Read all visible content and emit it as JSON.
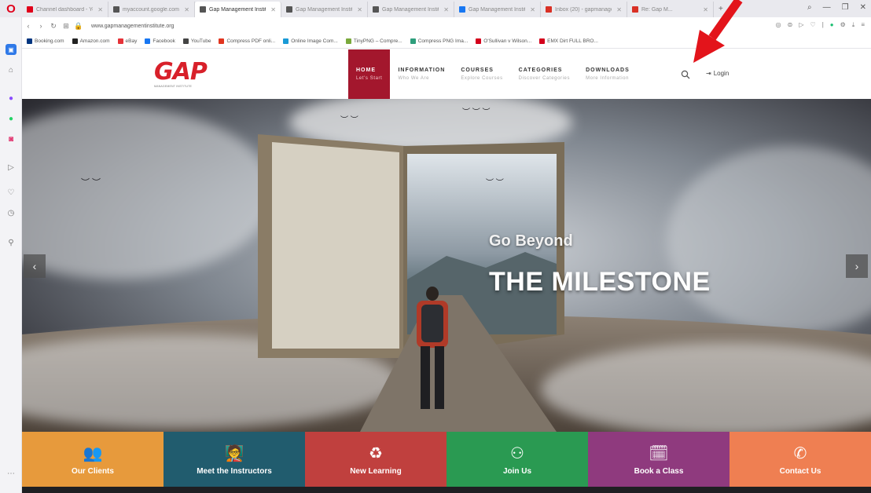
{
  "browser": {
    "tabs": [
      {
        "label": "Channel dashboard - YouT",
        "color": "#e0001a",
        "active": false
      },
      {
        "label": "myaccount.google.com",
        "color": "#555",
        "active": false
      },
      {
        "label": "Gap Management Institute",
        "color": "#555",
        "active": true
      },
      {
        "label": "Gap Management Institute",
        "color": "#555",
        "active": false
      },
      {
        "label": "Gap Management Institute",
        "color": "#555",
        "active": false
      },
      {
        "label": "Gap Management Institute",
        "color": "#1877f2",
        "active": false
      },
      {
        "label": "Inbox (20) - gapmanagem",
        "color": "#d93025",
        "active": false
      },
      {
        "label": "Re: Gap M...",
        "color": "#d93025",
        "active": false
      }
    ],
    "url": "www.gapmanagementinstitute.org",
    "bookmarks": [
      {
        "label": "Booking.com",
        "color": "#003580"
      },
      {
        "label": "Amazon.com",
        "color": "#222"
      },
      {
        "label": "eBay",
        "color": "#e53238"
      },
      {
        "label": "Facebook",
        "color": "#1877f2"
      },
      {
        "label": "YouTube",
        "color": "#444"
      },
      {
        "label": "Compress PDF onli...",
        "color": "#e1351f"
      },
      {
        "label": "Online Image Com...",
        "color": "#1a9ad6"
      },
      {
        "label": "TinyPNG – Compre...",
        "color": "#7aa93c"
      },
      {
        "label": "Compress PNG Ima...",
        "color": "#2e9e7c"
      },
      {
        "label": "O'Sullivan v Wilson...",
        "color": "#d4001c"
      },
      {
        "label": "EMX Dirt FULL BRO...",
        "color": "#d4001c"
      }
    ]
  },
  "site": {
    "logo": {
      "text": "GAP",
      "subtext": "MANAGEMENT INSTITUTE"
    },
    "menu": [
      {
        "title": "HOME",
        "subtitle": "Let's Start",
        "active": true
      },
      {
        "title": "INFORMATION",
        "subtitle": "Who We Are",
        "active": false
      },
      {
        "title": "COURSES",
        "subtitle": "Explore Courses",
        "active": false
      },
      {
        "title": "CATEGORIES",
        "subtitle": "Discover Categories",
        "active": false
      },
      {
        "title": "DOWNLOADS",
        "subtitle": "More Information",
        "active": false
      }
    ],
    "login_label": "Login",
    "accent": "#a3172d"
  },
  "hero": {
    "subtitle": "Go Beyond",
    "title": "THE MILESTONE",
    "prev_icon": "‹",
    "next_icon": "›"
  },
  "features": [
    {
      "label": "Our Clients",
      "icon": "users-icon",
      "glyph": "👥",
      "color": "#e79a3c"
    },
    {
      "label": "Meet the Instructors",
      "icon": "instructor-icon",
      "glyph": "🧑‍🏫",
      "color": "#215c6e"
    },
    {
      "label": "New Learning",
      "icon": "learning-icon",
      "glyph": "♻",
      "color": "#c0403e"
    },
    {
      "label": "Join Us",
      "icon": "team-icon",
      "glyph": "⚇",
      "color": "#2a9a52"
    },
    {
      "label": "Book a Class",
      "icon": "book-class-icon",
      "glyph": "🗓",
      "color": "#8f3a7e"
    },
    {
      "label": "Contact Us",
      "icon": "phone-icon",
      "glyph": "✆",
      "color": "#ef7f52"
    }
  ]
}
